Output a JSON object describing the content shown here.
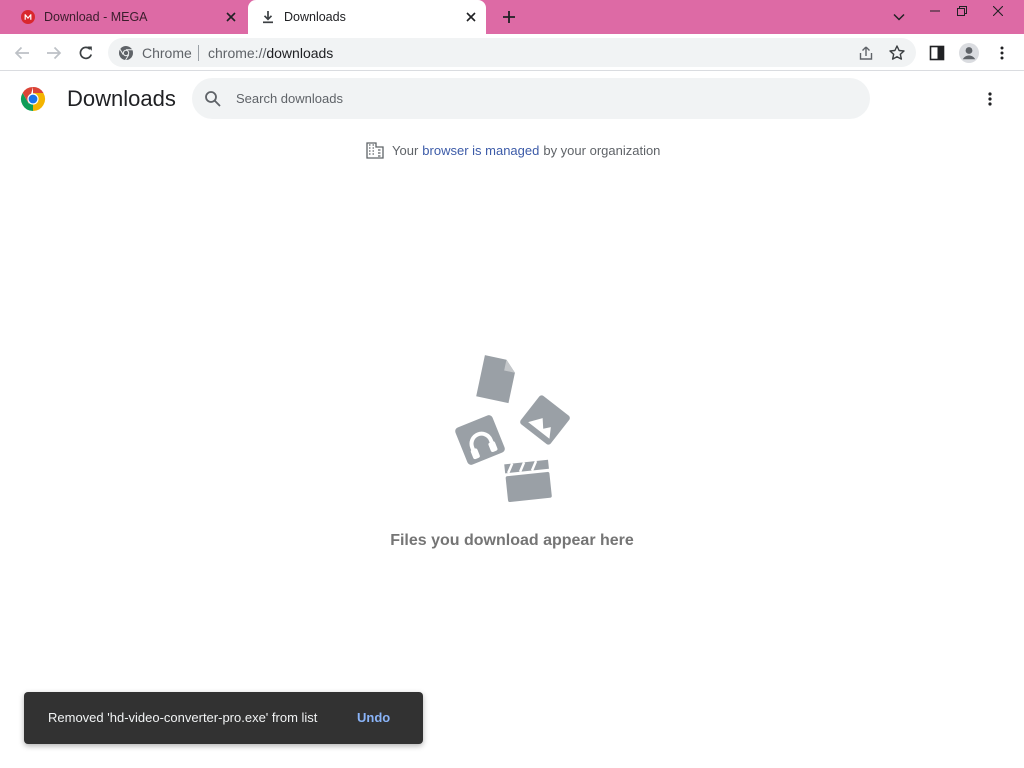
{
  "colors": {
    "tabstrip_bg": "#dd6aa5",
    "accent_link": "#3c5ba8",
    "toast_bg": "#323232",
    "toast_action": "#8ab4f8",
    "empty_art": "#9aa0a6"
  },
  "tabs": [
    {
      "title": "Download - MEGA",
      "icon": "mega-icon",
      "active": false
    },
    {
      "title": "Downloads",
      "icon": "download-icon",
      "active": true
    }
  ],
  "window_controls": [
    "chevron-down-icon",
    "minimize-icon",
    "restore-icon",
    "close-icon"
  ],
  "toolbar": {
    "back": "back-arrow-icon",
    "forward": "forward-arrow-icon",
    "reload": "reload-icon",
    "site_chip": "Chrome",
    "url_scheme": "chrome://",
    "url_host": "downloads",
    "share": "share-icon",
    "bookmark": "star-icon",
    "side_panel": "side-panel-icon",
    "profile": "profile-icon",
    "menu": "kebab-menu-icon"
  },
  "page": {
    "title": "Downloads",
    "search_placeholder": "Search downloads"
  },
  "managed_notice": {
    "prefix": "Your",
    "link": "browser is managed",
    "suffix": "by your organization"
  },
  "empty_state": {
    "text": "Files you download appear here"
  },
  "toast": {
    "message": "Removed 'hd-video-converter-pro.exe' from list",
    "action": "Undo"
  }
}
